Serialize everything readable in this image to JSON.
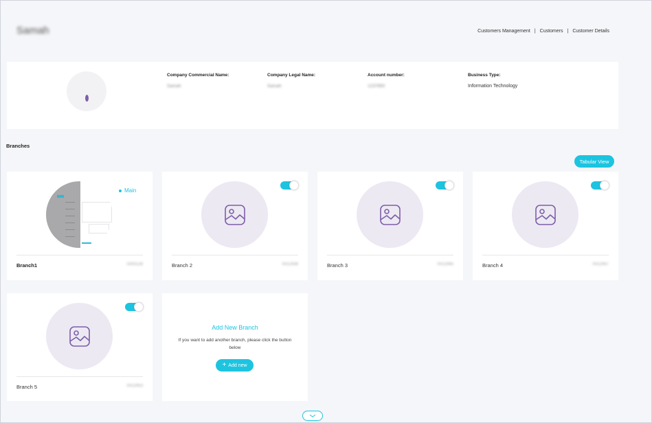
{
  "header": {
    "user_name": "Samah",
    "breadcrumb": [
      "Customers Management",
      "Customers",
      "Customer Details"
    ],
    "separator": "|"
  },
  "company": {
    "commercial_name_label": "Company Commercial Name:",
    "commercial_name_value": "Samah",
    "legal_name_label": "Company Legal Name:",
    "legal_name_value": "Samah",
    "account_number_label": "Account number:",
    "account_number_value": "1237850",
    "business_type_label": "Business Type:",
    "business_type_value": "Information Technology"
  },
  "branches": {
    "title": "Branches",
    "tabular_view_label": "Tabular View",
    "main_label": "Main",
    "items": [
      {
        "name": "Branch1",
        "code": "0000128",
        "active": true
      },
      {
        "name": "Branch 2",
        "code": "0012938",
        "active": true
      },
      {
        "name": "Branch 3",
        "code": "0012945",
        "active": true
      },
      {
        "name": "Branch 4",
        "code": "0012947",
        "active": true
      },
      {
        "name": "Branch 5",
        "code": "0012953",
        "active": true
      }
    ],
    "add_new": {
      "title": "Add New Branch",
      "text": "If you want to add another branch, please click the button below",
      "button_label": "Add new",
      "button_icon": "+"
    }
  },
  "colors": {
    "accent": "#1cc4e0",
    "placeholder_circle": "#ece9f3",
    "placeholder_icon": "#7e5ea8"
  },
  "icons": {
    "image_placeholder": "image-icon",
    "scroll_down": "chevron-down-icon"
  }
}
